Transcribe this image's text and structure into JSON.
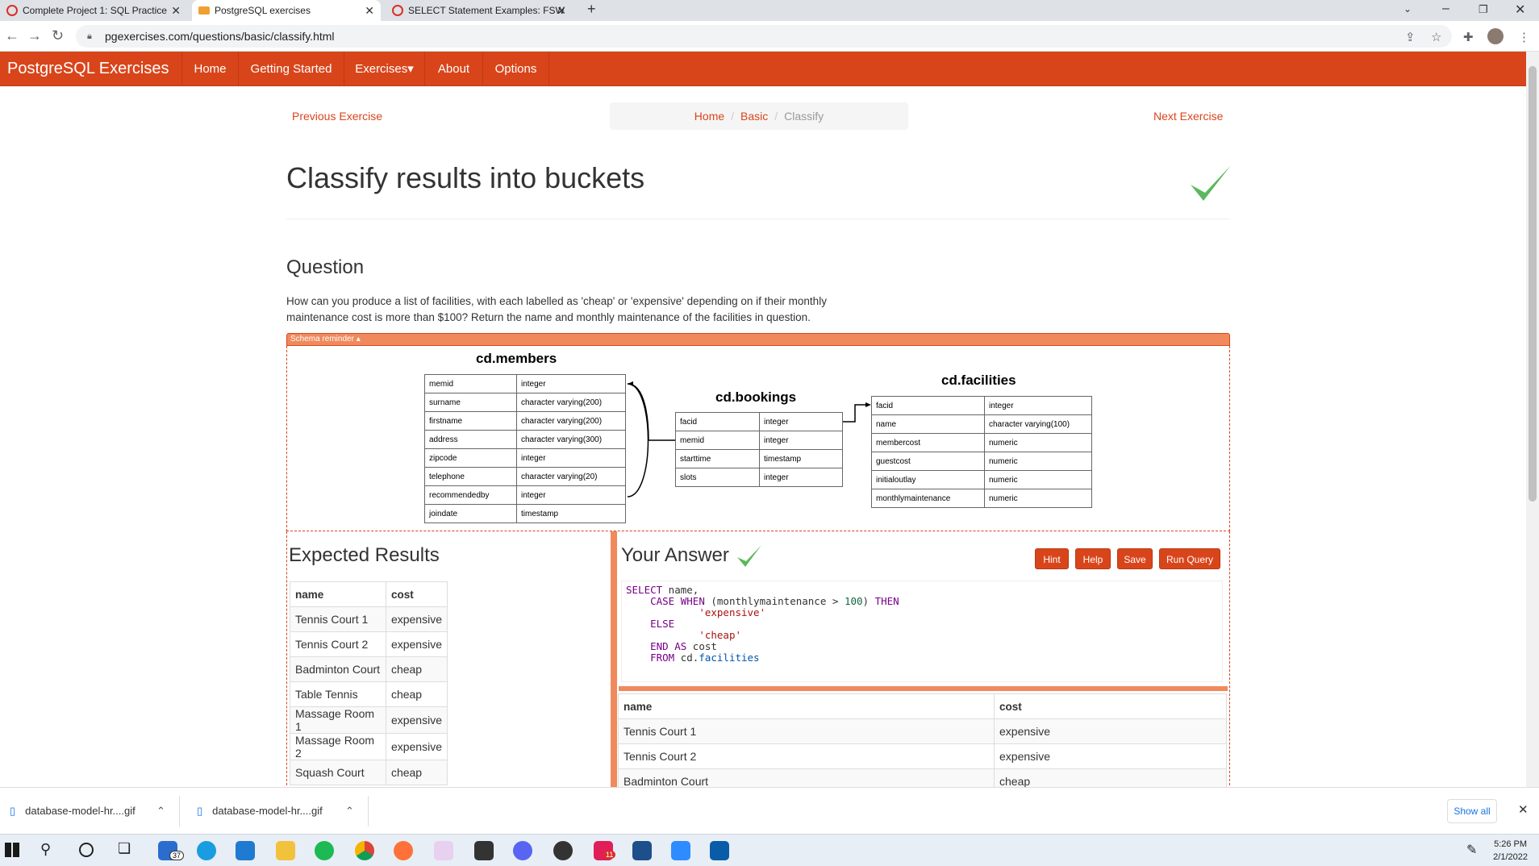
{
  "browser": {
    "tabs": [
      {
        "title": "Complete Project 1: SQL Practice",
        "active": false
      },
      {
        "title": "PostgreSQL exercises",
        "active": true
      },
      {
        "title": "SELECT Statement Examples: FSW",
        "active": false
      }
    ],
    "url": "pgexercises.com/questions/basic/classify.html"
  },
  "navbar": {
    "brand": "PostgreSQL Exercises",
    "items": [
      "Home",
      "Getting Started",
      "Exercises▾",
      "About",
      "Options"
    ],
    "color": "#d9451b"
  },
  "page": {
    "prev": "Previous Exercise",
    "next": "Next Exercise",
    "breadcrumb": [
      "Home",
      "Basic",
      "Classify"
    ],
    "title": "Classify results into buckets",
    "question_heading": "Question",
    "question_text": "How can you produce a list of facilities, with each labelled as 'cheap' or 'expensive' depending on if their monthly maintenance cost is more than $100? Return the name and monthly maintenance of the facilities in question.",
    "schema_reminder": "Schema reminder ▴"
  },
  "schema": {
    "members": {
      "title": "cd.members",
      "rows": [
        [
          "memid",
          "integer"
        ],
        [
          "surname",
          "character varying(200)"
        ],
        [
          "firstname",
          "character varying(200)"
        ],
        [
          "address",
          "character varying(300)"
        ],
        [
          "zipcode",
          "integer"
        ],
        [
          "telephone",
          "character varying(20)"
        ],
        [
          "recommendedby",
          "integer"
        ],
        [
          "joindate",
          "timestamp"
        ]
      ]
    },
    "bookings": {
      "title": "cd.bookings",
      "rows": [
        [
          "facid",
          "integer"
        ],
        [
          "memid",
          "integer"
        ],
        [
          "starttime",
          "timestamp"
        ],
        [
          "slots",
          "integer"
        ]
      ]
    },
    "facilities": {
      "title": "cd.facilities",
      "rows": [
        [
          "facid",
          "integer"
        ],
        [
          "name",
          "character varying(100)"
        ],
        [
          "membercost",
          "numeric"
        ],
        [
          "guestcost",
          "numeric"
        ],
        [
          "initialoutlay",
          "numeric"
        ],
        [
          "monthlymaintenance",
          "numeric"
        ]
      ]
    }
  },
  "expected": {
    "heading": "Expected Results",
    "columns": [
      "name",
      "cost"
    ],
    "rows": [
      [
        "Tennis Court 1",
        "expensive"
      ],
      [
        "Tennis Court 2",
        "expensive"
      ],
      [
        "Badminton Court",
        "cheap"
      ],
      [
        "Table Tennis",
        "cheap"
      ],
      [
        "Massage Room 1",
        "expensive"
      ],
      [
        "Massage Room 2",
        "expensive"
      ],
      [
        "Squash Court",
        "cheap"
      ]
    ]
  },
  "answer": {
    "heading": "Your Answer",
    "buttons": [
      "Hint",
      "Help",
      "Save",
      "Run Query"
    ],
    "columns": [
      "name",
      "cost"
    ],
    "rows": [
      [
        "Tennis Court 1",
        "expensive"
      ],
      [
        "Tennis Court 2",
        "expensive"
      ],
      [
        "Badminton Court",
        "cheap"
      ]
    ]
  },
  "downloads": {
    "items": [
      "database-model-hr....gif",
      "database-model-hr....gif"
    ],
    "show_all": "Show all"
  },
  "taskbar": {
    "time": "5:26 PM",
    "date": "2/1/2022",
    "mail_badge": "37",
    "chrome_badge": "11"
  }
}
